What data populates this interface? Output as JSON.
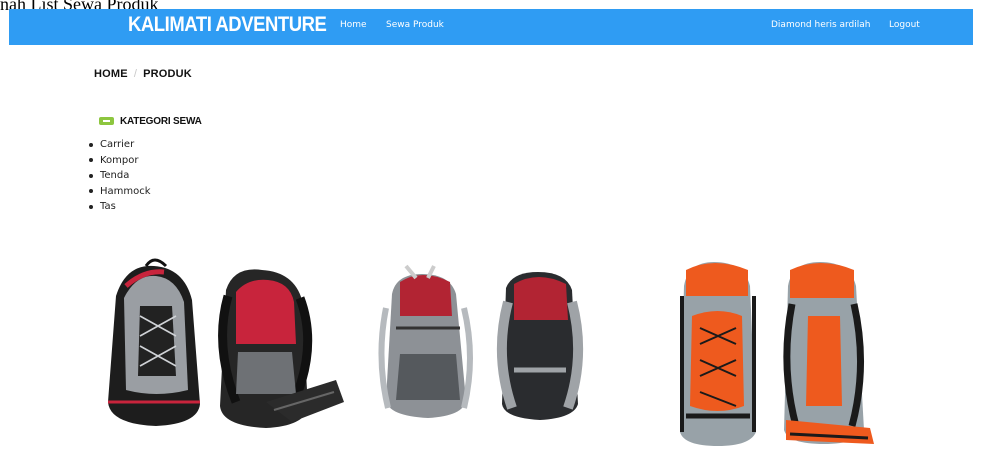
{
  "document_title": "nah List Sewa Produk",
  "navbar": {
    "brand": "KALIMATI ADVENTURE",
    "links": [
      "Home",
      "Sewa Produk"
    ],
    "user_name": "Diamond heris ardilah",
    "logout_label": "Logout",
    "color": "#2f9cf3"
  },
  "breadcrumb": {
    "home": "HOME",
    "separator": "/",
    "current": "PRODUK"
  },
  "category": {
    "title": "KATEGORI SEWA",
    "toggle_icon": "minus-icon",
    "accent_color": "#8dc63f",
    "items": [
      "Carrier",
      "Kompor",
      "Tenda",
      "Hammock",
      "Tas"
    ]
  },
  "products": [
    {
      "icon": "backpack-black-grey-red-image"
    },
    {
      "icon": "backpack-grey-red-image"
    },
    {
      "icon": "backpack-orange-grey-image"
    }
  ]
}
